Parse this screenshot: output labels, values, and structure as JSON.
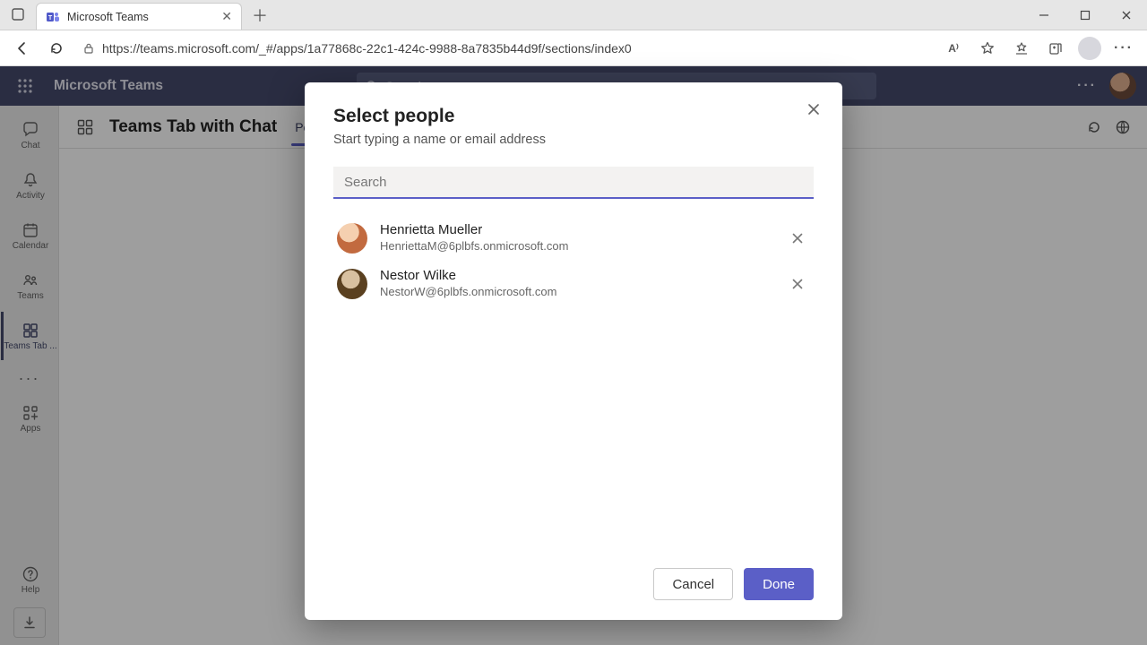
{
  "browser": {
    "tab_title": "Microsoft Teams",
    "url": "https://teams.microsoft.com/_#/apps/1a77868c-22c1-424c-9988-8a7835b44d9f/sections/index0"
  },
  "teams": {
    "brand": "Microsoft Teams",
    "search_placeholder": "Search",
    "rail": [
      {
        "id": "chat",
        "label": "Chat"
      },
      {
        "id": "activity",
        "label": "Activity"
      },
      {
        "id": "calendar",
        "label": "Calendar"
      },
      {
        "id": "teams",
        "label": "Teams"
      },
      {
        "id": "teamstab",
        "label": "Teams Tab ..."
      },
      {
        "id": "apps",
        "label": "Apps"
      },
      {
        "id": "help",
        "label": "Help"
      }
    ],
    "content": {
      "title": "Teams Tab with Chat",
      "tabs": [
        {
          "label": "Personal Tab",
          "active": true
        }
      ]
    }
  },
  "modal": {
    "title": "Select people",
    "subtitle": "Start typing a name or email address",
    "search_placeholder": "Search",
    "people": [
      {
        "name": "Henrietta Mueller",
        "email": "HenriettaM@6plbfs.onmicrosoft.com"
      },
      {
        "name": "Nestor Wilke",
        "email": "NestorW@6plbfs.onmicrosoft.com"
      }
    ],
    "cancel_label": "Cancel",
    "done_label": "Done"
  }
}
